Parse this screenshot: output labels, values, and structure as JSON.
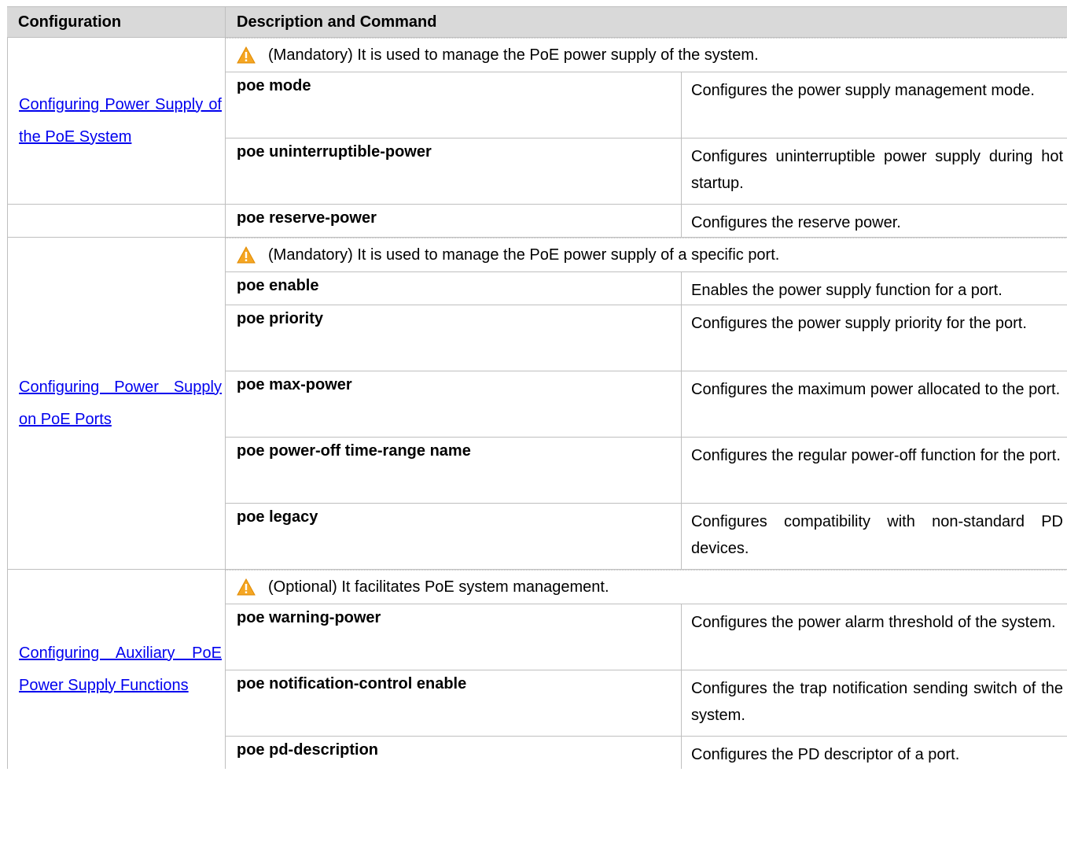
{
  "header": {
    "col1": "Configuration",
    "col2": "Description and Command"
  },
  "groups": [
    {
      "link": "Configuring Power Supply of the PoE System",
      "note": "(Mandatory) It is used to manage the PoE power supply of the system.",
      "rows": [
        {
          "cmd": "poe mode",
          "desc": "Configures the power supply management mode."
        },
        {
          "cmd": "poe uninterruptible-power",
          "desc": "Configures uninterruptible power supply during hot startup."
        }
      ]
    },
    {
      "rows": [
        {
          "cmd": "poe reserve-power",
          "desc": "Configures the reserve power."
        }
      ]
    },
    {
      "link": "Configuring Power Supply on PoE Ports",
      "note": "(Mandatory) It is used to manage the PoE power supply of a specific port.",
      "rows": [
        {
          "cmd": "poe enable",
          "desc": "Enables the power supply function for a port."
        },
        {
          "cmd": "poe priority",
          "desc": "Configures the power supply priority for the port."
        },
        {
          "cmd": "poe max-power",
          "desc": "Configures the maximum power allocated to the port."
        },
        {
          "cmd": "poe power-off time-range name",
          "desc": "Configures the regular power-off function for the port."
        },
        {
          "cmd": "poe legacy",
          "desc": "Configures compatibility with non-standard PD devices."
        }
      ]
    },
    {
      "link": "Configuring Auxiliary PoE Power Supply Functions",
      "note": "(Optional) It facilitates PoE system management.",
      "rows": [
        {
          "cmd": "poe warning-power",
          "desc": "Configures the power alarm threshold of the system."
        },
        {
          "cmd": "poe notification-control enable",
          "desc": "Configures the trap notification sending switch of the system."
        },
        {
          "cmd": "poe pd-description",
          "desc": "Configures the PD descriptor of a port."
        }
      ]
    }
  ],
  "icons": {
    "note": "warning-triangle-icon"
  },
  "colors": {
    "header_bg": "#d9d9d9",
    "link": "#0000ee",
    "warning": "#f5a623"
  }
}
